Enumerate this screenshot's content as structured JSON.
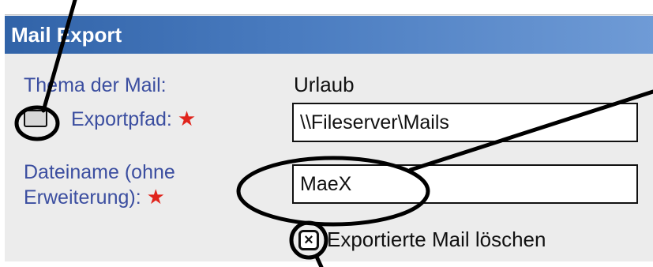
{
  "dialog": {
    "title": "Mail Export"
  },
  "fields": {
    "subject_label": "Thema der Mail:",
    "subject_value": "Urlaub",
    "exportpath_label": "Exportpfad:",
    "exportpath_value": "\\\\Fileserver\\Mails",
    "filename_label_line1": "Dateiname (ohne",
    "filename_label_line2": "Erweiterung):",
    "filename_value": "MaeX",
    "required_star": "★"
  },
  "options": {
    "delete_checkbox_mark": "×",
    "delete_checkbox_checked": true,
    "delete_label": "Exportierte Mail löschen"
  },
  "colors": {
    "title_bar": "#3163a8",
    "label_text": "#3b4ea0",
    "required_star": "#e0241c"
  }
}
